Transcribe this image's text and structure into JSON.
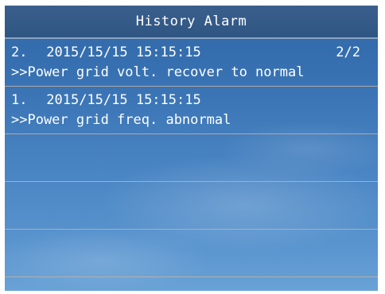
{
  "header": {
    "title": "History Alarm"
  },
  "alarms": [
    {
      "index": "2.",
      "timestamp": "2015/15/15 15:15:15",
      "page": "2/2",
      "message": ">>Power grid volt. recover to normal"
    },
    {
      "index": "1.",
      "timestamp": "2015/15/15 15:15:15",
      "message": ">>Power grid freq. abnormal"
    }
  ],
  "colors": {
    "background_top": "#2f66a6",
    "background_bottom": "#6aa2d6",
    "title_bar": "#3b5f8d",
    "separator": "#c4b2a0",
    "text": "#ffffff"
  }
}
